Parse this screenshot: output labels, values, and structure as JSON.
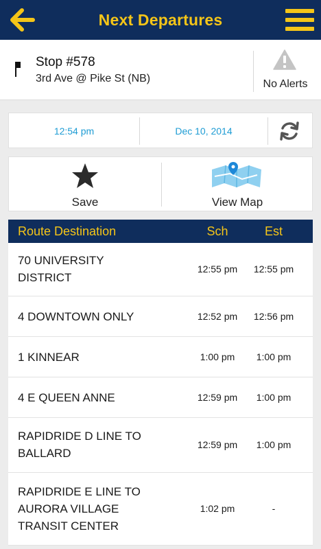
{
  "header": {
    "title": "Next Departures",
    "back_icon": "back-arrow-icon",
    "menu_icon": "hamburger-menu-icon",
    "accent_color": "#f5c518",
    "bar_color": "#0f2d5c"
  },
  "stop": {
    "number": "Stop #578",
    "name": "3rd Ave @ Pike St  (NB)",
    "alerts_label": "No Alerts"
  },
  "timebar": {
    "time": "12:54 pm",
    "date": "Dec 10, 2014",
    "link_color": "#1e9cd4"
  },
  "actions": {
    "save_label": "Save",
    "map_label": "View Map"
  },
  "table": {
    "headers": {
      "destination": "Route Destination",
      "scheduled": "Sch",
      "estimated": "Est"
    },
    "rows": [
      {
        "destination": "70   UNIVERSITY\nDISTRICT",
        "sch": "12:55 pm",
        "est": "12:55 pm"
      },
      {
        "destination": "4   DOWNTOWN ONLY",
        "sch": "12:52 pm",
        "est": "12:56 pm"
      },
      {
        "destination": "1   KINNEAR",
        "sch": "1:00 pm",
        "est": "1:00 pm"
      },
      {
        "destination": "4   E QUEEN ANNE",
        "sch": "12:59 pm",
        "est": "1:00 pm"
      },
      {
        "destination": "RAPIDRIDE D LINE TO\nBALLARD",
        "sch": "12:59 pm",
        "est": "1:00 pm"
      },
      {
        "destination": "RAPIDRIDE E LINE TO\nAURORA VILLAGE\nTRANSIT CENTER",
        "sch": "1:02 pm",
        "est": "-"
      }
    ]
  }
}
